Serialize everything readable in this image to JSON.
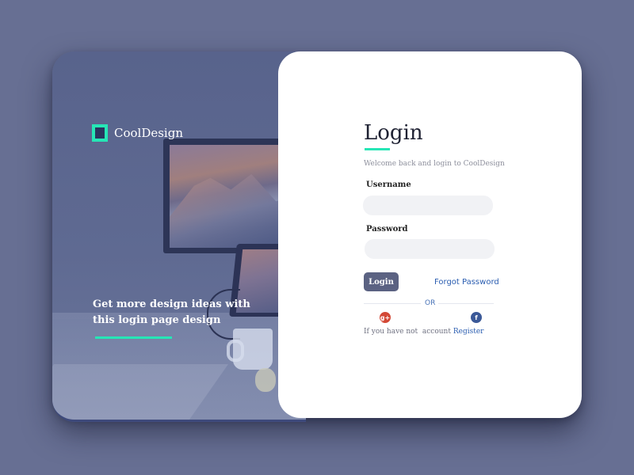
{
  "brand": {
    "name": "CoolDesign",
    "logo_icon": "square-outline-icon",
    "accent_color": "#26e6b6"
  },
  "left_panel": {
    "tagline": "Get more design ideas with this login page design",
    "background_color": "#5f6a92"
  },
  "login_form": {
    "title": "Login",
    "welcome_text": "Welcome back and login to CoolDesign",
    "username_label": "Username",
    "username_value": "",
    "password_label": "Password",
    "password_value": "",
    "login_button_label": "Login",
    "forgot_password_label": "Forgot Password",
    "divider_text": "OR",
    "social": [
      {
        "icon": "google-plus-icon",
        "glyph": "g+",
        "color": "#d34836"
      },
      {
        "icon": "facebook-icon",
        "glyph": "f",
        "color": "#3b5998"
      }
    ],
    "register_prompt": "If you have not  account ",
    "register_link": "Register"
  },
  "colors": {
    "page_background": "#676f93",
    "button": "#5b6282",
    "link": "#2a5db0"
  }
}
